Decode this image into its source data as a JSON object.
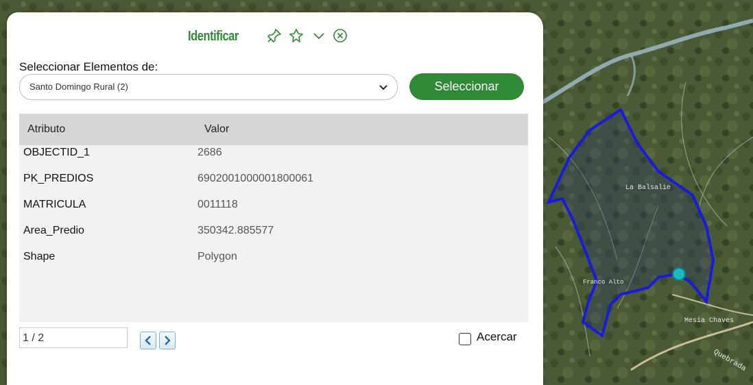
{
  "panel": {
    "title": "Identificar",
    "icons": [
      "pin-icon",
      "pin-outline-icon",
      "chevron-down-icon",
      "close-icon"
    ]
  },
  "select_section": {
    "label": "Seleccionar Elementos de:",
    "dropdown_value": "Santo Domingo Rural (2)",
    "button_label": "Seleccionar"
  },
  "table": {
    "headers": [
      "Atributo",
      "Valor"
    ],
    "rows": [
      {
        "attr": "OBJECTID_1",
        "value": "2686"
      },
      {
        "attr": "PK_PREDIOS",
        "value": "6902001000001800061"
      },
      {
        "attr": "MATRICULA",
        "value": "0011118"
      },
      {
        "attr": "Area_Predio",
        "value": "350342.885577"
      },
      {
        "attr": "Shape",
        "value": "Polygon"
      }
    ]
  },
  "pager": {
    "value": "1 / 2",
    "prev_icon": "chevron-left-icon",
    "next_icon": "chevron-right-icon"
  },
  "zoom_checkbox": {
    "label": "Acercar",
    "checked": false
  },
  "map": {
    "labels": [
      "La Balsalie",
      "Franco Alto",
      "Mesia Chaves",
      "Quebrada"
    ],
    "polygon_color": "#1a1adf"
  }
}
